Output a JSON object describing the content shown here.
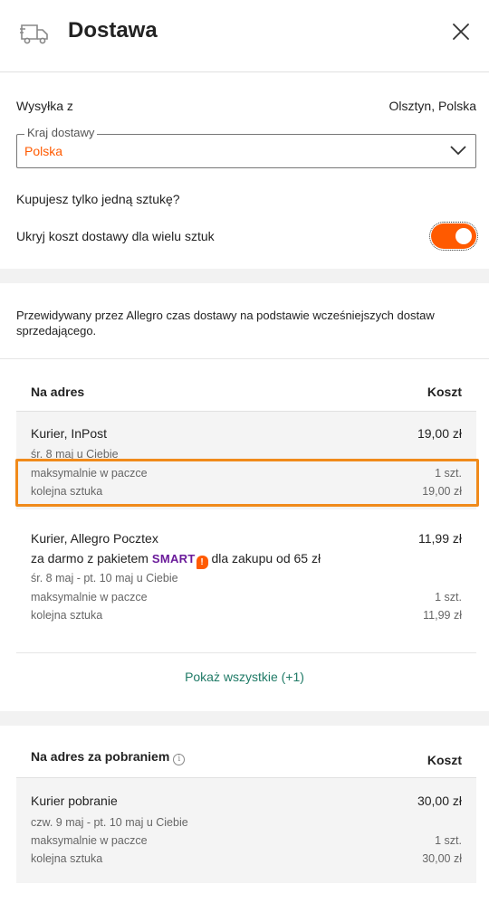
{
  "header": {
    "title": "Dostawa",
    "icon": "truck-icon",
    "close_icon": "close-icon"
  },
  "shipping": {
    "from_label": "Wysyłka z",
    "from_value": "Olsztyn, Polska",
    "country_legend": "Kraj dostawy",
    "country_value": "Polska",
    "one_piece_question": "Kupujesz tylko jedną sztukę?",
    "hide_cost_label": "Ukryj koszt dostawy dla wielu sztuk",
    "hide_cost_toggle_on": true
  },
  "info": {
    "text": "Przewidywany przez Allegro czas dostawy na podstawie wcześniejszych dostaw sprzedającego."
  },
  "to_address": {
    "header_left": "Na adres",
    "header_right": "Koszt",
    "rows": [
      {
        "name": "Kurier, InPost",
        "price": "19,00 zł",
        "date": "śr. 8 maj u Ciebie",
        "max_label": "maksymalnie w paczce",
        "max_value": "1 szt.",
        "next_label": "kolejna sztuka",
        "next_value": "19,00 zł"
      },
      {
        "name": "Kurier, Allegro Pocztex",
        "price": "11,99 zł",
        "promo_prefix": "za darmo z pakietem",
        "promo_brand": "SMART",
        "promo_badge": "!",
        "promo_suffix": "dla zakupu od 65 zł",
        "date": "śr. 8 maj - pt. 10 maj u Ciebie",
        "max_label": "maksymalnie w paczce",
        "max_value": "1 szt.",
        "next_label": "kolejna sztuka",
        "next_value": "11,99 zł"
      }
    ],
    "show_all": "Pokaż wszystkie (+1)"
  },
  "cod": {
    "header_left": "Na adres za pobraniem",
    "header_info_icon": "i",
    "header_right": "Koszt",
    "rows": [
      {
        "name": "Kurier pobranie",
        "price": "30,00 zł",
        "date": "czw. 9 maj - pt. 10 maj u Ciebie",
        "max_label": "maksymalnie w paczce",
        "max_value": "1 szt.",
        "next_label": "kolejna sztuka",
        "next_value": "30,00 zł"
      }
    ]
  },
  "colors": {
    "accent": "#ff5a00",
    "link": "#1f7a66",
    "smart": "#6a1b9a",
    "highlight": "#f08a1a"
  }
}
